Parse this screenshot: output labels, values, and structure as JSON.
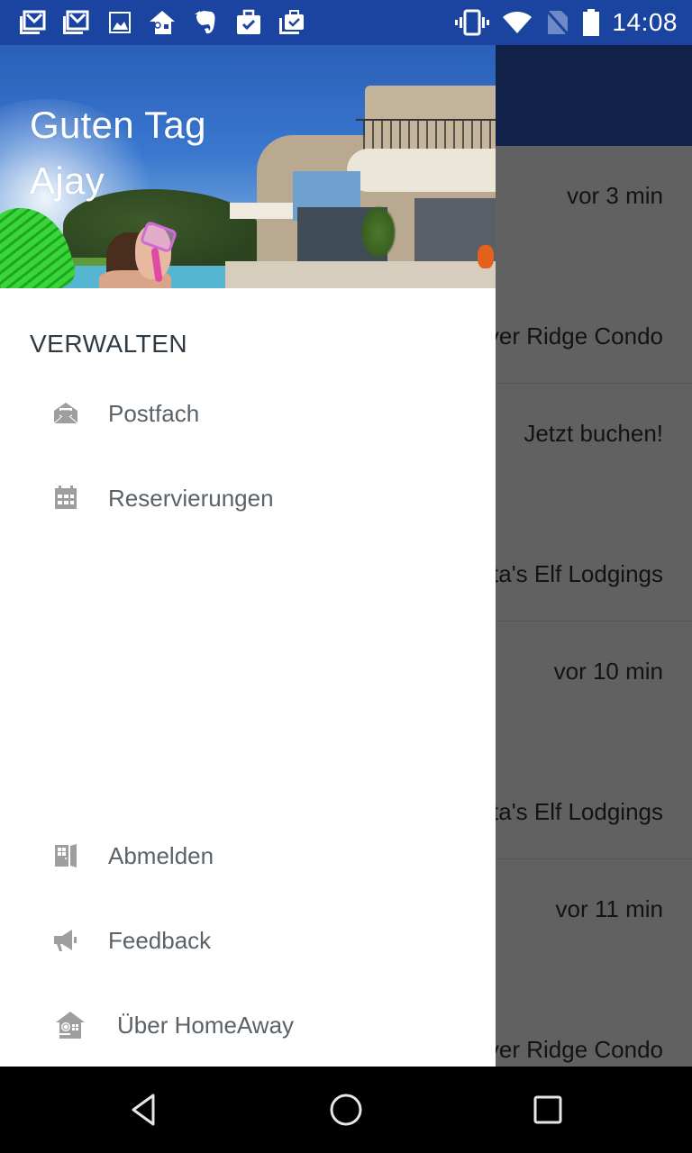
{
  "status_bar": {
    "notification_icons": [
      "gmail-icon",
      "gmail-icon",
      "image-icon",
      "homeaway-icon",
      "evernote-icon",
      "briefcase-check-icon",
      "briefcase-check-icon"
    ],
    "system_icons": [
      "vibrate-icon",
      "wifi-icon",
      "no-sim-icon",
      "battery-icon"
    ],
    "time": "14:08",
    "background_color": "#1a44a0"
  },
  "drawer": {
    "greeting_line1": "Guten Tag",
    "greeting_line2": "Ajay",
    "section_title": "VERWALTEN",
    "items": [
      {
        "label": "Postfach",
        "icon": "envelope-open-icon"
      },
      {
        "label": "Reservierungen",
        "icon": "calendar-icon"
      }
    ],
    "footer_items": [
      {
        "label": "Abmelden",
        "icon": "door-exit-icon"
      },
      {
        "label": "Feedback",
        "icon": "megaphone-icon"
      },
      {
        "label": "Über HomeAway",
        "icon": "homeaway-house-icon"
      }
    ],
    "icon_color": "#9e9e9e",
    "label_color": "#5a6268"
  },
  "background_list": {
    "items": [
      {
        "time": "vor 3 min",
        "title": "Silver Ridge Condo"
      },
      {
        "time": "Jetzt buchen!",
        "title": "Santa's Elf Lodgings"
      },
      {
        "time": "vor 10 min",
        "title": "Santa's Elf Lodgings"
      },
      {
        "time": "vor 11 min",
        "title": "Silver Ridge Condo"
      }
    ]
  },
  "nav_bar": {
    "buttons": [
      "back",
      "home",
      "recents"
    ]
  }
}
